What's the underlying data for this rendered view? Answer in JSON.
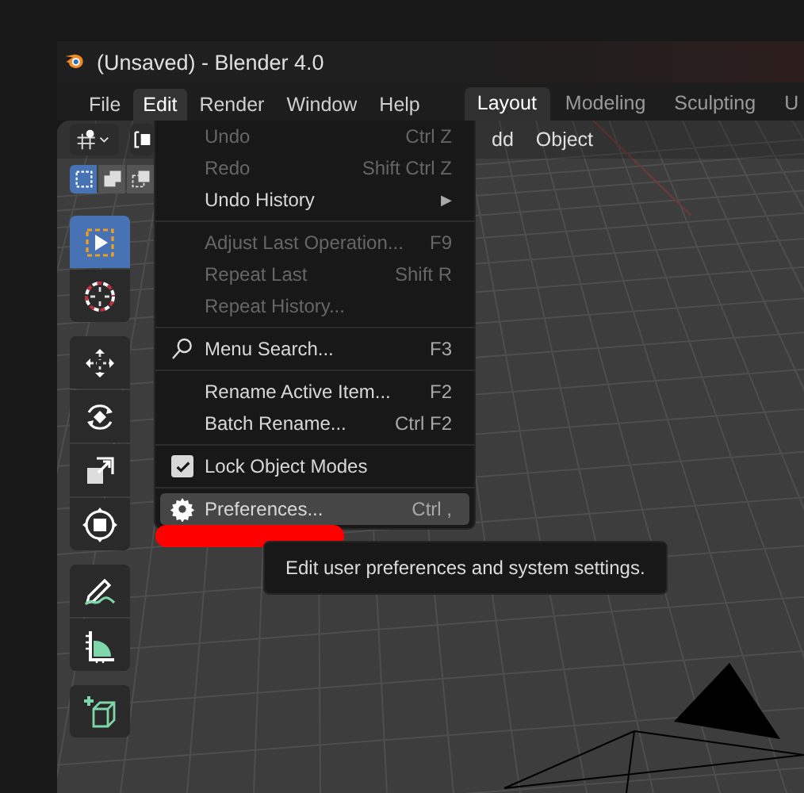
{
  "window": {
    "title": "(Unsaved) - Blender 4.0"
  },
  "menu_bar": [
    {
      "label": "File",
      "selected": false
    },
    {
      "label": "Edit",
      "selected": true
    },
    {
      "label": "Render",
      "selected": false
    },
    {
      "label": "Window",
      "selected": false
    },
    {
      "label": "Help",
      "selected": false
    }
  ],
  "workspace_tabs": [
    {
      "label": "Layout",
      "selected": true
    },
    {
      "label": "Modeling",
      "selected": false
    },
    {
      "label": "Sculpting",
      "selected": false
    },
    {
      "label": "U",
      "selected": false
    }
  ],
  "viewport_header": {
    "menus": [
      "dd",
      "Object"
    ]
  },
  "select_modes": [
    {
      "kind": "new",
      "selected": true
    },
    {
      "kind": "extend",
      "selected": false
    },
    {
      "kind": "subtract",
      "selected": false
    }
  ],
  "toolbar": {
    "tool_groups": [
      [
        {
          "kind": "select",
          "selected": true
        },
        {
          "kind": "cursor",
          "selected": false
        }
      ],
      [
        {
          "kind": "move",
          "selected": false
        },
        {
          "kind": "rotate",
          "selected": false
        },
        {
          "kind": "scale",
          "selected": false
        },
        {
          "kind": "transform",
          "selected": false
        }
      ],
      [
        {
          "kind": "annotate",
          "selected": false
        },
        {
          "kind": "measure",
          "selected": false
        }
      ],
      [
        {
          "kind": "add-cube",
          "selected": false
        }
      ]
    ]
  },
  "edit_menu": {
    "sections": [
      [
        {
          "kind": "command",
          "label": "Undo",
          "shortcut": "Ctrl Z",
          "disabled": true,
          "highlighted": false
        },
        {
          "kind": "command",
          "label": "Redo",
          "shortcut": "Shift Ctrl Z",
          "disabled": true,
          "highlighted": false
        },
        {
          "kind": "submenu",
          "label": "Undo History",
          "shortcut": "▶",
          "disabled": false,
          "highlighted": false
        }
      ],
      [
        {
          "kind": "command",
          "label": "Adjust Last Operation...",
          "shortcut": "F9",
          "disabled": true,
          "highlighted": false
        },
        {
          "kind": "command",
          "label": "Repeat Last",
          "shortcut": "Shift R",
          "disabled": true,
          "highlighted": false
        },
        {
          "kind": "command",
          "label": "Repeat History...",
          "disabled": true,
          "highlighted": false
        }
      ],
      [
        {
          "kind": "search",
          "label": "Menu Search...",
          "shortcut": "F3",
          "disabled": false,
          "highlighted": false
        }
      ],
      [
        {
          "kind": "command",
          "label": "Rename Active Item...",
          "shortcut": "F2",
          "disabled": false,
          "highlighted": false
        },
        {
          "kind": "command",
          "label": "Batch Rename...",
          "shortcut": "Ctrl F2",
          "disabled": false,
          "highlighted": false
        }
      ],
      [
        {
          "kind": "checkbox",
          "label": "Lock Object Modes",
          "checked": true,
          "disabled": false,
          "highlighted": false
        }
      ],
      [
        {
          "kind": "settings",
          "label": "Preferences...",
          "shortcut": "Ctrl ,",
          "disabled": false,
          "highlighted": true
        }
      ]
    ]
  },
  "tooltip": {
    "text": "Edit user preferences and system settings."
  }
}
